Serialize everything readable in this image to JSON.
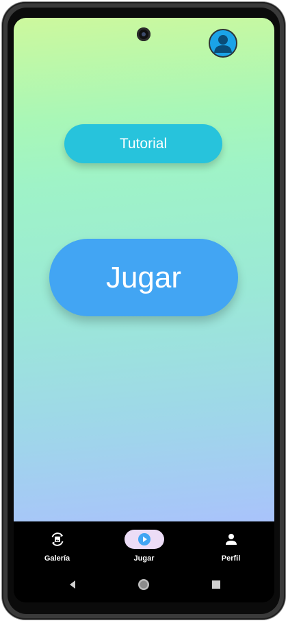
{
  "screen": {
    "buttons": {
      "tutorial_label": "Tutorial",
      "play_label": "Jugar"
    },
    "profile_icon": "user-avatar-icon"
  },
  "bottom_nav": {
    "items": [
      {
        "label": "Galería",
        "icon": "gallery-icon",
        "active": false
      },
      {
        "label": "Jugar",
        "icon": "play-circle-icon",
        "active": true
      },
      {
        "label": "Perfil",
        "icon": "person-icon",
        "active": false
      }
    ]
  },
  "system_nav": {
    "items": [
      "back-icon",
      "home-icon",
      "recents-icon"
    ]
  },
  "colors": {
    "tutorial_button": "#27c3dc",
    "play_button": "#42a5f3",
    "nav_active_pill": "#ecdcf6",
    "nav_background": "#000000"
  }
}
